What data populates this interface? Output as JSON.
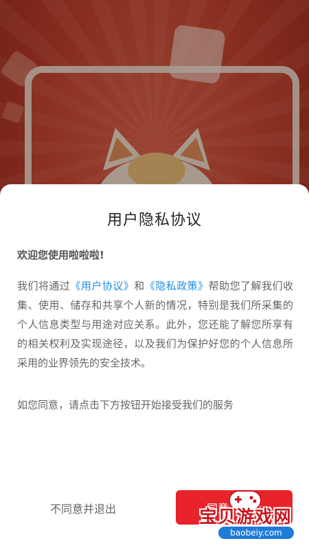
{
  "dialog": {
    "title": "用户隐私协议",
    "welcome": "欢迎您使用啦啦啦!",
    "body_part1": "我们将通过",
    "link_user_agreement": "《用户协议》",
    "body_and": "和",
    "link_privacy_policy": "《隐私政策》",
    "body_part2": "帮助您了解我们收集、使用、储存和共享个人新的情况，特别是我们所采集的个人信息类型与用途对应关系。此外，您还能了解您所享有的相关权利及实现途径，以及我们为保护好您的个人信息所采用的业界领先的安全技术。",
    "consent": "如您同意，请点击下方按钮开始接受我们的服务",
    "disagree_label": "不同意并退出",
    "agree_label": "同意并继续"
  },
  "watermark": {
    "text": "宝贝游戏网",
    "url": "baobeiy.com"
  },
  "colors": {
    "accent_red": "#e8242a",
    "link_blue": "#1f8ee6"
  }
}
